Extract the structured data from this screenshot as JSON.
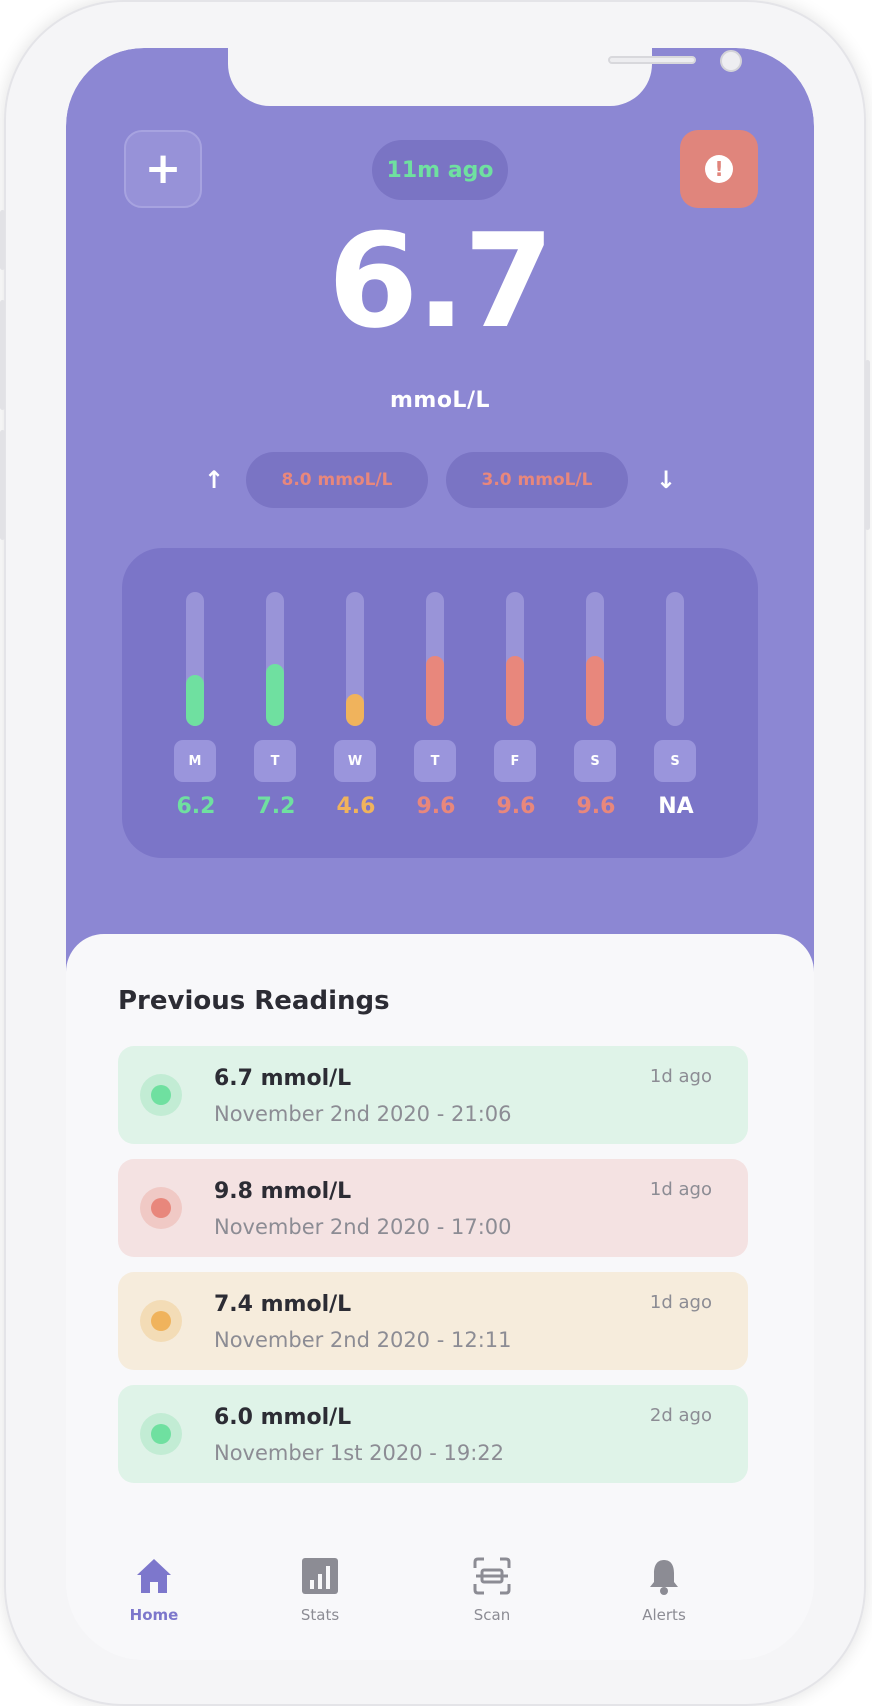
{
  "header": {
    "add_icon": "plus-icon",
    "last_updated": "11m ago",
    "alert_icon": "exclamation-icon",
    "current_reading": "6.7",
    "unit": "mmoL/L",
    "high_arrow": "↑",
    "high_threshold": "8.0 mmoL/L",
    "low_threshold": "3.0 mmoL/L",
    "low_arrow": "↓"
  },
  "weekly": {
    "days": [
      {
        "day": "M",
        "value": "6.2",
        "level": 0.38,
        "color": "#6fe0a0"
      },
      {
        "day": "T",
        "value": "7.2",
        "level": 0.46,
        "color": "#6fe0a0"
      },
      {
        "day": "W",
        "value": "4.6",
        "level": 0.24,
        "color": "#f0b35c"
      },
      {
        "day": "T",
        "value": "9.6",
        "level": 0.52,
        "color": "#e8877c"
      },
      {
        "day": "F",
        "value": "9.6",
        "level": 0.52,
        "color": "#e8877c"
      },
      {
        "day": "S",
        "value": "9.6",
        "level": 0.52,
        "color": "#e8877c"
      },
      {
        "day": "S",
        "value": "NA",
        "level": 0,
        "color": "#ffffff"
      }
    ]
  },
  "previous": {
    "title": "Previous Readings",
    "items": [
      {
        "value": "6.7 mmol/L",
        "date": "November 2nd 2020 - 21:06",
        "ago": "1d ago",
        "status": "normal"
      },
      {
        "value": "9.8 mmol/L",
        "date": "November 2nd 2020 - 17:00",
        "ago": "1d ago",
        "status": "high"
      },
      {
        "value": "7.4 mmol/L",
        "date": "November 2nd 2020 - 12:11",
        "ago": "1d ago",
        "status": "elevated"
      },
      {
        "value": "6.0 mmol/L",
        "date": "November 1st 2020 - 19:22",
        "ago": "2d ago",
        "status": "normal"
      }
    ]
  },
  "colors": {
    "normal": {
      "bg": "#dff3e8",
      "dot": "#6fe0a0",
      "ring": "#c2ecd4"
    },
    "high": {
      "bg": "#f4e2e2",
      "dot": "#e8877c",
      "ring": "#f0c9c5"
    },
    "elevated": {
      "bg": "#f6ecdc",
      "dot": "#f0b35c",
      "ring": "#f3dcb6"
    },
    "accent": "#8c87d3"
  },
  "tabs": [
    {
      "label": "Home",
      "icon": "home-icon",
      "active": true
    },
    {
      "label": "Stats",
      "icon": "stats-icon",
      "active": false
    },
    {
      "label": "Scan",
      "icon": "scan-icon",
      "active": false
    },
    {
      "label": "Alerts",
      "icon": "bell-icon",
      "active": false
    }
  ]
}
